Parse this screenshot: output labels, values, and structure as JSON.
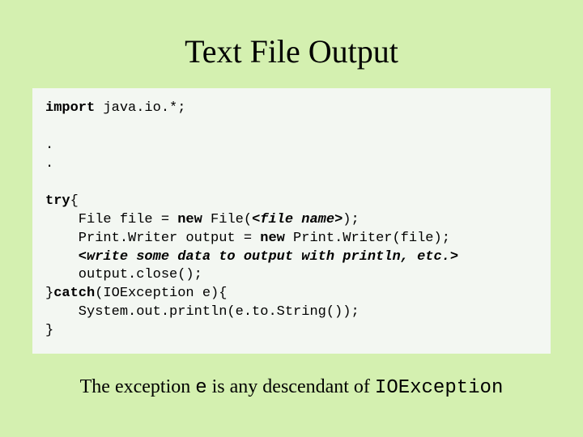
{
  "title": "Text File Output",
  "code": {
    "l1a": "import",
    "l1b": " java.io.*;",
    "blank1": "",
    "l2": ".",
    "l3": ".",
    "blank2": "",
    "l4a": "try",
    "l4b": "{",
    "l5a": "    File file = ",
    "l5b": "new",
    "l5c": " File(",
    "l5d": "<file name>",
    "l5e": ");",
    "l6a": "    Print.Writer output = ",
    "l6b": "new",
    "l6c": " Print.Writer(file);",
    "l7": "    <write some data to output with println, etc.>",
    "l8": "    output.close();",
    "l9a": "}",
    "l9b": "catch",
    "l9c": "(IOException e){",
    "l10": "    System.out.println(e.to.String());",
    "l11": "}"
  },
  "caption": {
    "t1": "The exception ",
    "m1": "e",
    "t2": " is any descendant of ",
    "m2": "IOException"
  }
}
